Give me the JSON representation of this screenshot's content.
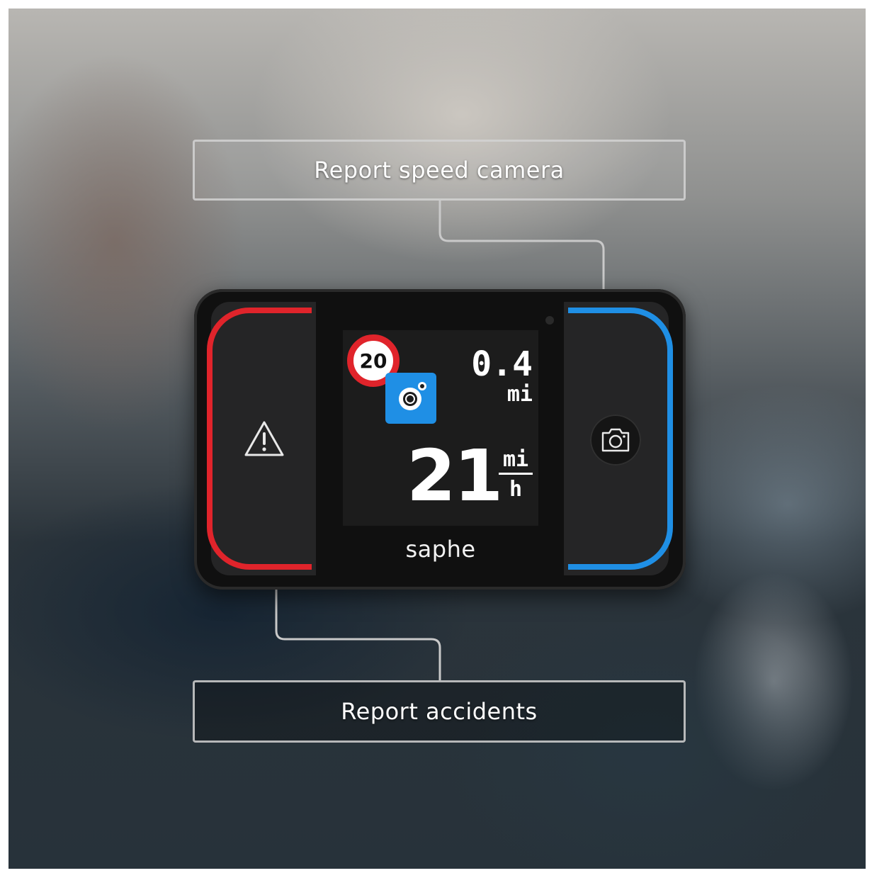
{
  "callouts": {
    "top": "Report speed camera",
    "bottom": "Report accidents"
  },
  "device": {
    "brand": "saphe",
    "accent_left": "#e0242b",
    "accent_right": "#1f8fe5",
    "left_button_icon": "warning-triangle-icon",
    "right_button_icon": "camera-icon"
  },
  "screen": {
    "speed_limit": "20",
    "alert_icon": "speed-camera-icon",
    "distance_value": "0.4",
    "distance_unit": "mi",
    "speed_value": "21",
    "speed_unit_top": "mi",
    "speed_unit_bottom": "h"
  }
}
